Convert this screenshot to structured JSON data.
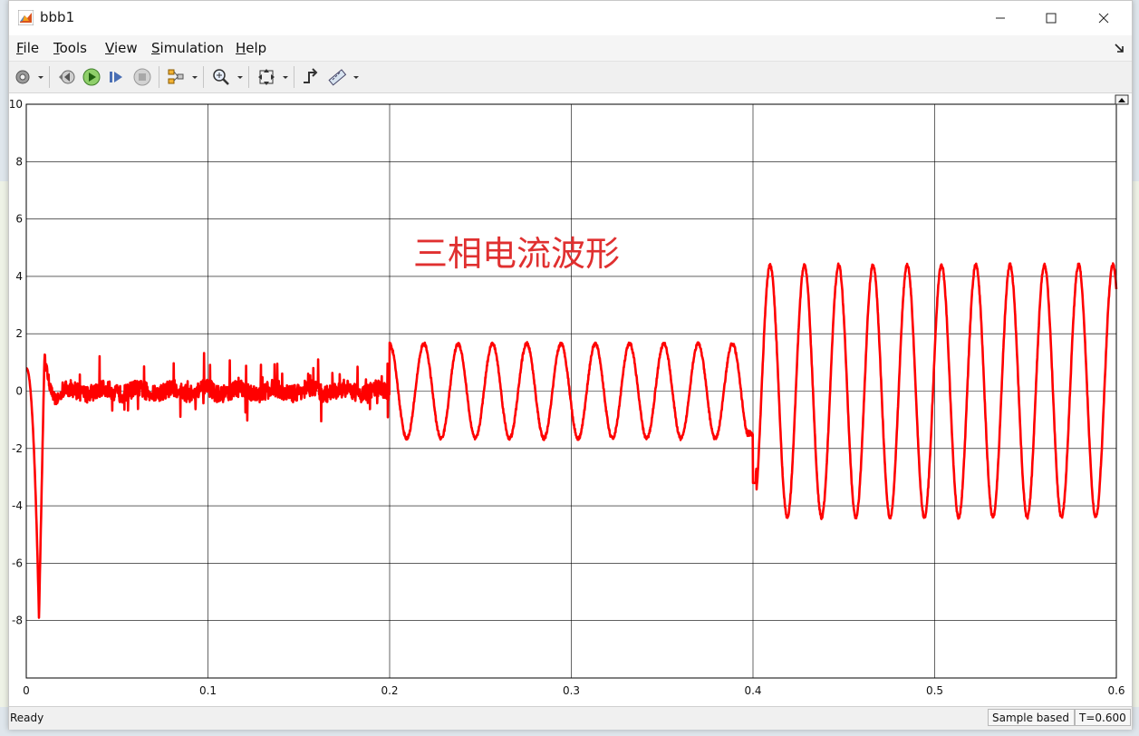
{
  "window": {
    "title": "bbb1"
  },
  "menu": {
    "file": {
      "accel": "F",
      "rest": "ile"
    },
    "tools": {
      "accel": "T",
      "rest": "ools"
    },
    "view": {
      "accel": "V",
      "rest": "iew"
    },
    "simulation": {
      "accel": "S",
      "rest": "imulation"
    },
    "help": {
      "accel": "H",
      "rest": "elp"
    }
  },
  "annotation": "三相电流波形",
  "status": {
    "ready": "Ready",
    "sample_mode": "Sample based",
    "time": "T=0.600"
  },
  "colors": {
    "trace": "#ff0000",
    "grid": "#000000",
    "annotation": "#e03030"
  },
  "chart_data": {
    "type": "line",
    "xlim": [
      0,
      0.6
    ],
    "ylim": [
      -10,
      10
    ],
    "x_ticks": [
      0,
      0.1,
      0.2,
      0.3,
      0.4,
      0.5,
      0.6
    ],
    "x_tick_labels": [
      "0",
      "0.1",
      "0.2",
      "0.3",
      "0.4",
      "0.5",
      "0.6"
    ],
    "y_ticks": [
      10,
      8,
      6,
      4,
      2,
      0,
      -2,
      -4,
      -6,
      -8
    ],
    "y_tick_labels": [
      "10",
      "8",
      "6",
      "4",
      "2",
      "0",
      "-2",
      "-4",
      "-6",
      "-8"
    ],
    "grid": true,
    "segments": [
      {
        "t_start": 0.0,
        "t_end": 0.2,
        "behavior": "transient then noise",
        "amplitude": 0.3,
        "transient": {
          "peak_time": 0.007,
          "peak_value": -7.9,
          "rebound": 1.2
        }
      },
      {
        "t_start": 0.2,
        "t_end": 0.4,
        "behavior": "sinusoid",
        "amplitude": 1.65,
        "frequency_hz": 53,
        "final_dip": -1.5
      },
      {
        "t_start": 0.4,
        "t_end": 0.6,
        "behavior": "sinusoid",
        "amplitude": 4.4,
        "frequency_hz": 53,
        "initial_dip": -3.2
      }
    ]
  }
}
